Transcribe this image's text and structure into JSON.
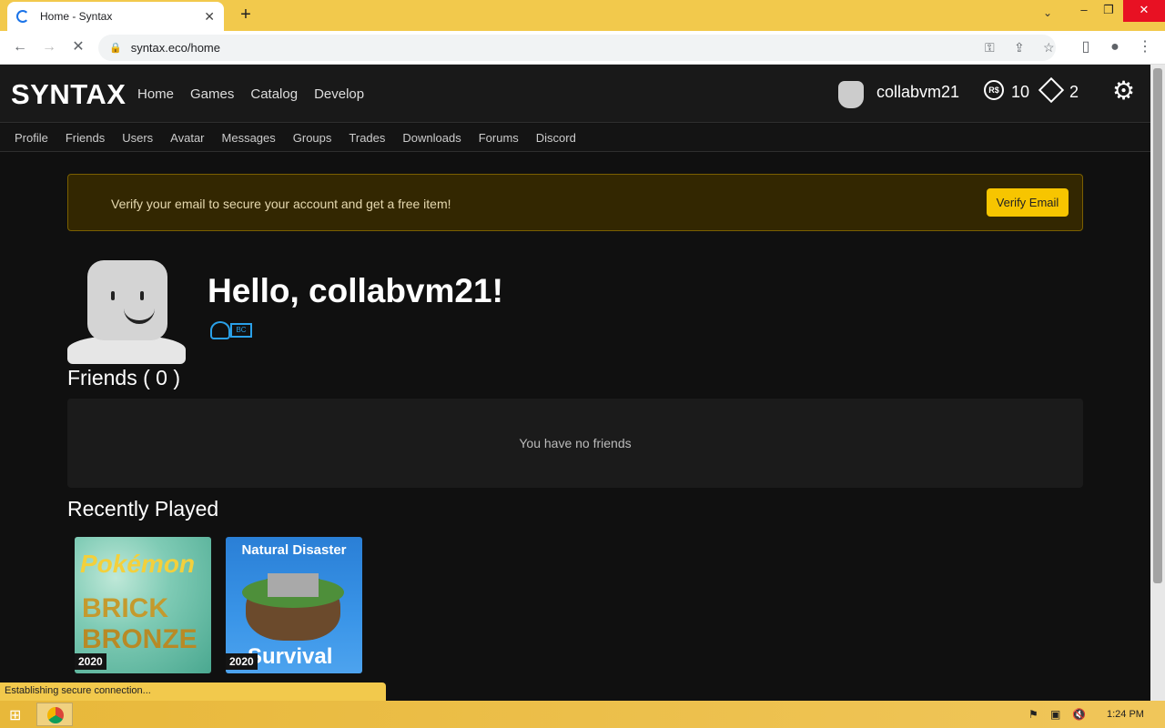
{
  "browser": {
    "tab_title": "Home - Syntax",
    "url": "syntax.eco/home",
    "status_text": "Establishing secure connection..."
  },
  "site": {
    "logo": "SYNTAX",
    "main_nav": [
      "Home",
      "Games",
      "Catalog",
      "Develop"
    ],
    "username": "collabvm21",
    "robux_icon": "R$",
    "robux": "10",
    "tickets": "2",
    "sub_nav": [
      "Profile",
      "Friends",
      "Users",
      "Avatar",
      "Messages",
      "Groups",
      "Trades",
      "Downloads",
      "Forums",
      "Discord"
    ]
  },
  "alert": {
    "text": "Verify your email to secure your account and get a free item!",
    "button": "Verify Email"
  },
  "home": {
    "greeting": "Hello, collabvm21!",
    "badge": "BC",
    "friends_title": "Friends ( 0 )",
    "friends_empty": "You have no friends",
    "recent_title": "Recently Played",
    "games": [
      {
        "top": "Pokémon",
        "mid": "BRICK",
        "bot": "BRONZE",
        "year": "2020"
      },
      {
        "top": "Natural Disaster",
        "bot": "Survival",
        "year": "2020"
      }
    ]
  },
  "taskbar": {
    "clock": "1:24 PM"
  },
  "colors": {
    "alert_bg": "#332701",
    "verify_button": "#f7c500",
    "browser_frame": "#f2c94c"
  }
}
